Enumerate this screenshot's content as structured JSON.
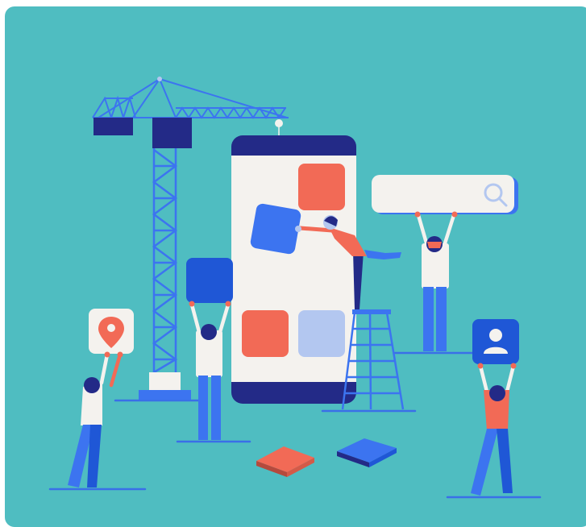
{
  "illustration": {
    "subject": "team-building-mobile-app",
    "icons": [
      "search-icon",
      "location-pin-icon",
      "user-icon"
    ]
  },
  "colors": {
    "background": "#4fbdc1",
    "navy": "#232a87",
    "blue": "#3c74f0",
    "royal": "#1f57d6",
    "coral": "#f26a56",
    "light_blue": "#b3c7f0",
    "offwhite": "#f4f2ee",
    "skin_dark": "#2b2f7a",
    "shadow_line": "#3a6fe8"
  }
}
